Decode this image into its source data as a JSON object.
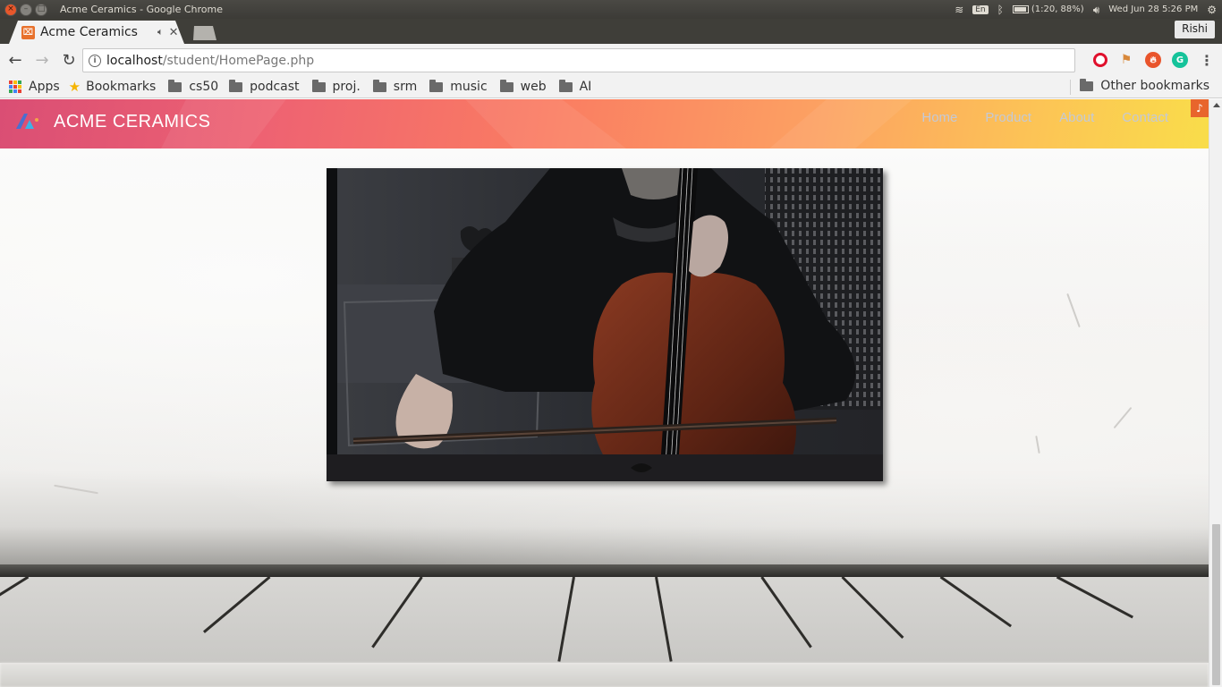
{
  "os": {
    "window_title": "Acme Ceramics - Google Chrome",
    "keyboard": "En",
    "battery": "(1:20, 88%)",
    "datetime": "Wed Jun 28  5:26 PM"
  },
  "browser": {
    "tab_title": "Acme Ceramics",
    "profile": "Rishi",
    "url_host": "localhost",
    "url_path": "/student/HomePage.php"
  },
  "bookmarks": {
    "apps": "Apps",
    "bookmarks": "Bookmarks",
    "folders": [
      "cs50",
      "podcast",
      "proj.",
      "srm",
      "music",
      "web",
      "AI"
    ],
    "other": "Other bookmarks"
  },
  "site": {
    "brand": "ACME CERAMICS",
    "nav": [
      "Home",
      "Product",
      "About",
      "Contact"
    ]
  },
  "colors": {
    "navbar_gradient_start": "#da4e74",
    "navbar_gradient_end": "#f9dd4a",
    "nav_link": "#c4c9d6",
    "music_badge": "#e8652c"
  },
  "icons": {
    "music_badge": "music-note-icon",
    "logo": "acme-logo-icon"
  }
}
